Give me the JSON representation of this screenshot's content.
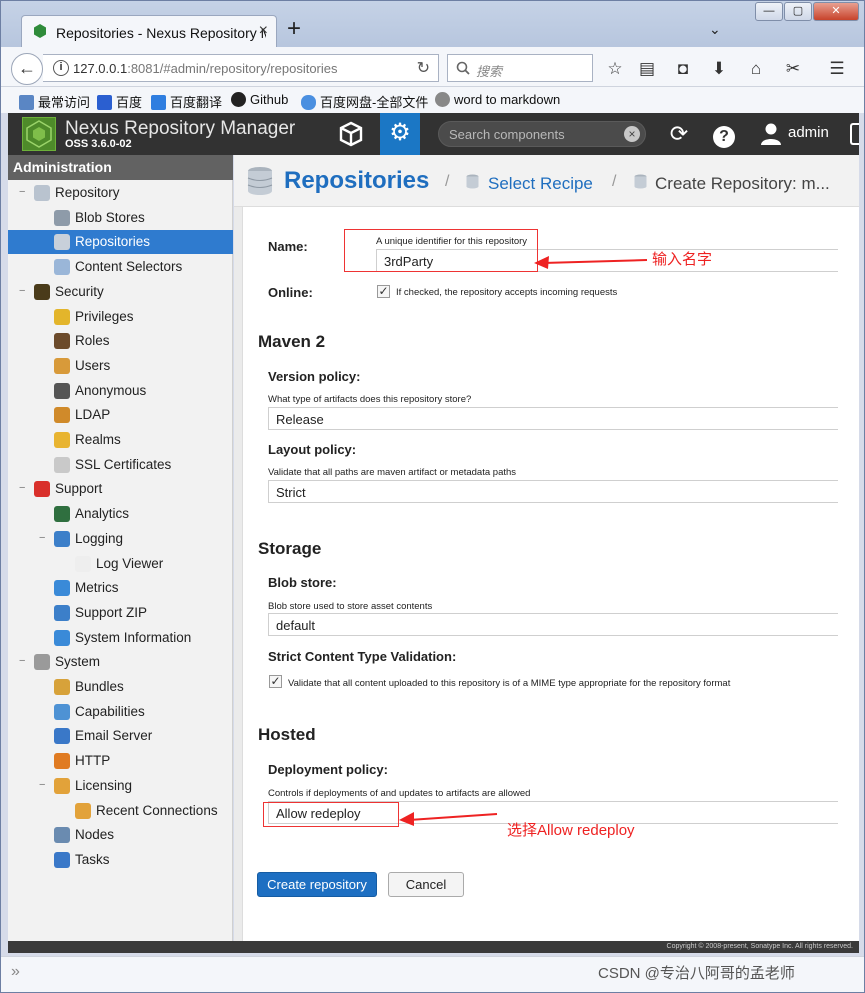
{
  "browser": {
    "tab_title": "Repositories - Nexus Repository M",
    "url_host": "127.0.0.1",
    "url_rest": ":8081/#admin/repository/repositories",
    "search_placeholder": "搜索",
    "bookmarks": [
      "最常访问",
      "百度",
      "百度翻译",
      "Github",
      "百度网盘-全部文件",
      "word to markdown"
    ]
  },
  "app": {
    "title": "Nexus Repository Manager",
    "version": "OSS 3.6.0-02",
    "search_placeholder": "Search components",
    "user": "admin"
  },
  "sidebar": {
    "title": "Administration",
    "items": [
      {
        "label": "Repository",
        "level": 0,
        "expander": "−",
        "icon": "database-icon",
        "color": "#b9c3cf"
      },
      {
        "label": "Blob Stores",
        "level": 1,
        "icon": "blob-store-icon",
        "color": "#8e9ba9"
      },
      {
        "label": "Repositories",
        "level": 1,
        "icon": "database-icon",
        "color": "#c8d0da",
        "selected": true
      },
      {
        "label": "Content Selectors",
        "level": 1,
        "icon": "content-selector-icon",
        "color": "#9ab6d8"
      },
      {
        "label": "Security",
        "level": 0,
        "expander": "−",
        "icon": "eye-icon",
        "color": "#4a3b1a"
      },
      {
        "label": "Privileges",
        "level": 1,
        "icon": "medal-icon",
        "color": "#e3b52b"
      },
      {
        "label": "Roles",
        "level": 1,
        "icon": "role-icon",
        "color": "#6c4b2b"
      },
      {
        "label": "Users",
        "level": 1,
        "icon": "users-icon",
        "color": "#d89a3a"
      },
      {
        "label": "Anonymous",
        "level": 1,
        "icon": "anonymous-icon",
        "color": "#555555"
      },
      {
        "label": "LDAP",
        "level": 1,
        "icon": "ldap-book-icon",
        "color": "#d08a2a"
      },
      {
        "label": "Realms",
        "level": 1,
        "icon": "shield-icon",
        "color": "#e8b431"
      },
      {
        "label": "SSL Certificates",
        "level": 1,
        "icon": "certificate-icon",
        "color": "#c9c9c9"
      },
      {
        "label": "Support",
        "level": 0,
        "expander": "−",
        "icon": "lifebuoy-icon",
        "color": "#d9302b"
      },
      {
        "label": "Analytics",
        "level": 1,
        "icon": "analytics-icon",
        "color": "#2f6f3f"
      },
      {
        "label": "Logging",
        "level": 1,
        "expander": "−",
        "icon": "logging-icon",
        "color": "#3c7fc9"
      },
      {
        "label": "Log Viewer",
        "level": 2,
        "icon": "log-viewer-icon",
        "color": "#eeeeee"
      },
      {
        "label": "Metrics",
        "level": 1,
        "icon": "pie-chart-icon",
        "color": "#3a8ad8"
      },
      {
        "label": "Support ZIP",
        "level": 1,
        "icon": "zip-icon",
        "color": "#3c7fc9"
      },
      {
        "label": "System Information",
        "level": 1,
        "icon": "globe-icon",
        "color": "#3a8ad8"
      },
      {
        "label": "System",
        "level": 0,
        "expander": "−",
        "icon": "gear-icon",
        "color": "#9a9a9a"
      },
      {
        "label": "Bundles",
        "level": 1,
        "icon": "puzzle-icon",
        "color": "#d7a23a"
      },
      {
        "label": "Capabilities",
        "level": 1,
        "icon": "cube-icon",
        "color": "#4e92d4"
      },
      {
        "label": "Email Server",
        "level": 1,
        "icon": "email-icon",
        "color": "#3a78c8"
      },
      {
        "label": "HTTP",
        "level": 1,
        "icon": "http-icon",
        "color": "#e07b22"
      },
      {
        "label": "Licensing",
        "level": 1,
        "expander": "−",
        "icon": "licensing-icon",
        "color": "#e2a23a"
      },
      {
        "label": "Recent Connections",
        "level": 2,
        "icon": "recent-connections-icon",
        "color": "#e2a23a"
      },
      {
        "label": "Nodes",
        "level": 1,
        "icon": "nodes-icon",
        "color": "#6a8bb0"
      },
      {
        "label": "Tasks",
        "level": 1,
        "icon": "clock-icon",
        "color": "#3a78c8"
      }
    ]
  },
  "breadcrumb": {
    "title": "Repositories",
    "step2": "Select Recipe",
    "step3": "Create Repository: m..."
  },
  "form": {
    "name_label": "Name:",
    "name_help": "A unique identifier for this repository",
    "name_value": "3rdParty",
    "online_label": "Online:",
    "online_help": "If checked, the repository accepts incoming requests",
    "maven_section": "Maven 2",
    "version_label": "Version policy:",
    "version_help": "What type of artifacts does this repository store?",
    "version_value": "Release",
    "layout_label": "Layout policy:",
    "layout_help": "Validate that all paths are maven artifact or metadata paths",
    "layout_value": "Strict",
    "storage_section": "Storage",
    "blob_label": "Blob store:",
    "blob_help": "Blob store used to store asset contents",
    "blob_value": "default",
    "strict_label": "Strict Content Type Validation:",
    "strict_help": "Validate that all content uploaded to this repository is of a MIME type appropriate for the repository format",
    "hosted_section": "Hosted",
    "deploy_label": "Deployment policy:",
    "deploy_help": "Controls if deployments of and updates to artifacts are allowed",
    "deploy_value": "Allow redeploy",
    "create_button": "Create repository",
    "cancel_button": "Cancel"
  },
  "annotations": {
    "name_note": "输入名字",
    "deploy_note": "选择Allow redeploy"
  },
  "footer": {
    "copyright": "Copyright © 2008-present, Sonatype Inc. All rights reserved."
  },
  "watermark": "CSDN @专治八阿哥的孟老师",
  "colors": {
    "accent": "#1b77c5",
    "selected": "#2f7bcf",
    "annotation": "#e22222",
    "header": "#323232"
  }
}
